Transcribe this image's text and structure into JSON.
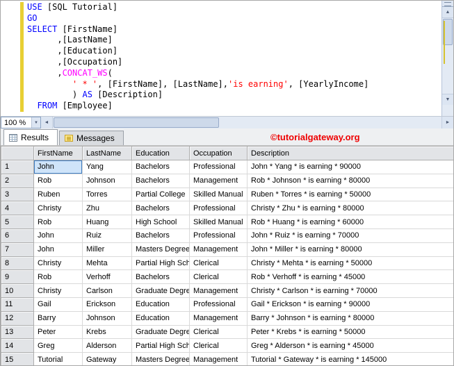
{
  "editor": {
    "zoom": "100 %",
    "lines": [
      [
        {
          "t": "kw",
          "s": "USE"
        },
        {
          "t": "pl",
          "s": " [SQL Tutorial]"
        }
      ],
      [
        {
          "t": "kw",
          "s": "GO"
        }
      ],
      [
        {
          "t": "kw",
          "s": "SELECT"
        },
        {
          "t": "pl",
          "s": " [FirstName]"
        }
      ],
      [
        {
          "t": "pl",
          "s": "      ,[LastName]"
        }
      ],
      [
        {
          "t": "pl",
          "s": "      ,[Education]"
        }
      ],
      [
        {
          "t": "pl",
          "s": "      ,[Occupation]"
        }
      ],
      [
        {
          "t": "pl",
          "s": "      ,"
        },
        {
          "t": "fn",
          "s": "CONCAT_WS"
        },
        {
          "t": "pl",
          "s": "("
        }
      ],
      [
        {
          "t": "pl",
          "s": "         "
        },
        {
          "t": "str",
          "s": "' * '"
        },
        {
          "t": "pl",
          "s": ", [FirstName], [LastName],"
        },
        {
          "t": "str",
          "s": "'is earning'"
        },
        {
          "t": "pl",
          "s": ", [YearlyIncome]"
        }
      ],
      [
        {
          "t": "pl",
          "s": "         ) "
        },
        {
          "t": "kw",
          "s": "AS"
        },
        {
          "t": "pl",
          "s": " [Description]"
        }
      ],
      [
        {
          "t": "pl",
          "s": "  "
        },
        {
          "t": "kw",
          "s": "FROM"
        },
        {
          "t": "pl",
          "s": " [Employee]"
        }
      ]
    ]
  },
  "icons": {
    "up_arrow": "▲",
    "down_arrow": "▼",
    "left_arrow": "◄",
    "right_arrow": "►",
    "dropdown_arrow": "▼"
  },
  "tabs": [
    {
      "label": "Results"
    },
    {
      "label": "Messages"
    }
  ],
  "watermark": "©tutorialgateway.org",
  "grid": {
    "columns": [
      "FirstName",
      "LastName",
      "Education",
      "Occupation",
      "Description"
    ],
    "selected_cell": {
      "row": 0,
      "col": 0
    },
    "rows": [
      [
        "John",
        "Yang",
        "Bachelors",
        "Professional",
        "John * Yang * is earning * 90000"
      ],
      [
        "Rob",
        "Johnson",
        "Bachelors",
        "Management",
        "Rob * Johnson * is earning * 80000"
      ],
      [
        "Ruben",
        "Torres",
        "Partial College",
        "Skilled Manual",
        "Ruben * Torres * is earning * 50000"
      ],
      [
        "Christy",
        "Zhu",
        "Bachelors",
        "Professional",
        "Christy * Zhu * is earning * 80000"
      ],
      [
        "Rob",
        "Huang",
        "High School",
        "Skilled Manual",
        "Rob * Huang * is earning * 60000"
      ],
      [
        "John",
        "Ruiz",
        "Bachelors",
        "Professional",
        "John * Ruiz * is earning * 70000"
      ],
      [
        "John",
        "Miller",
        "Masters Degree",
        "Management",
        "John * Miller * is earning * 80000"
      ],
      [
        "Christy",
        "Mehta",
        "Partial High School",
        "Clerical",
        "Christy * Mehta * is earning * 50000"
      ],
      [
        "Rob",
        "Verhoff",
        "Bachelors",
        "Clerical",
        "Rob * Verhoff * is earning * 45000"
      ],
      [
        "Christy",
        "Carlson",
        "Graduate Degree",
        "Management",
        "Christy * Carlson * is earning * 70000"
      ],
      [
        "Gail",
        "Erickson",
        "Education",
        "Professional",
        "Gail * Erickson * is earning * 90000"
      ],
      [
        "Barry",
        "Johnson",
        "Education",
        "Management",
        "Barry * Johnson * is earning * 80000"
      ],
      [
        "Peter",
        "Krebs",
        "Graduate Degree",
        "Clerical",
        "Peter * Krebs * is earning * 50000"
      ],
      [
        "Greg",
        "Alderson",
        "Partial High School",
        "Clerical",
        "Greg * Alderson * is earning * 45000"
      ],
      [
        "Tutorial",
        "Gateway",
        "Masters Degree",
        "Management",
        "Tutorial * Gateway * is earning * 145000"
      ]
    ]
  },
  "colors": {
    "keyword": "#0000ff",
    "string": "#ff0000",
    "function": "#ff00ff",
    "watermark_red": "#ee0000",
    "selection_blue": "#3e7cc1",
    "change_bar_yellow": "#e8cf34"
  }
}
